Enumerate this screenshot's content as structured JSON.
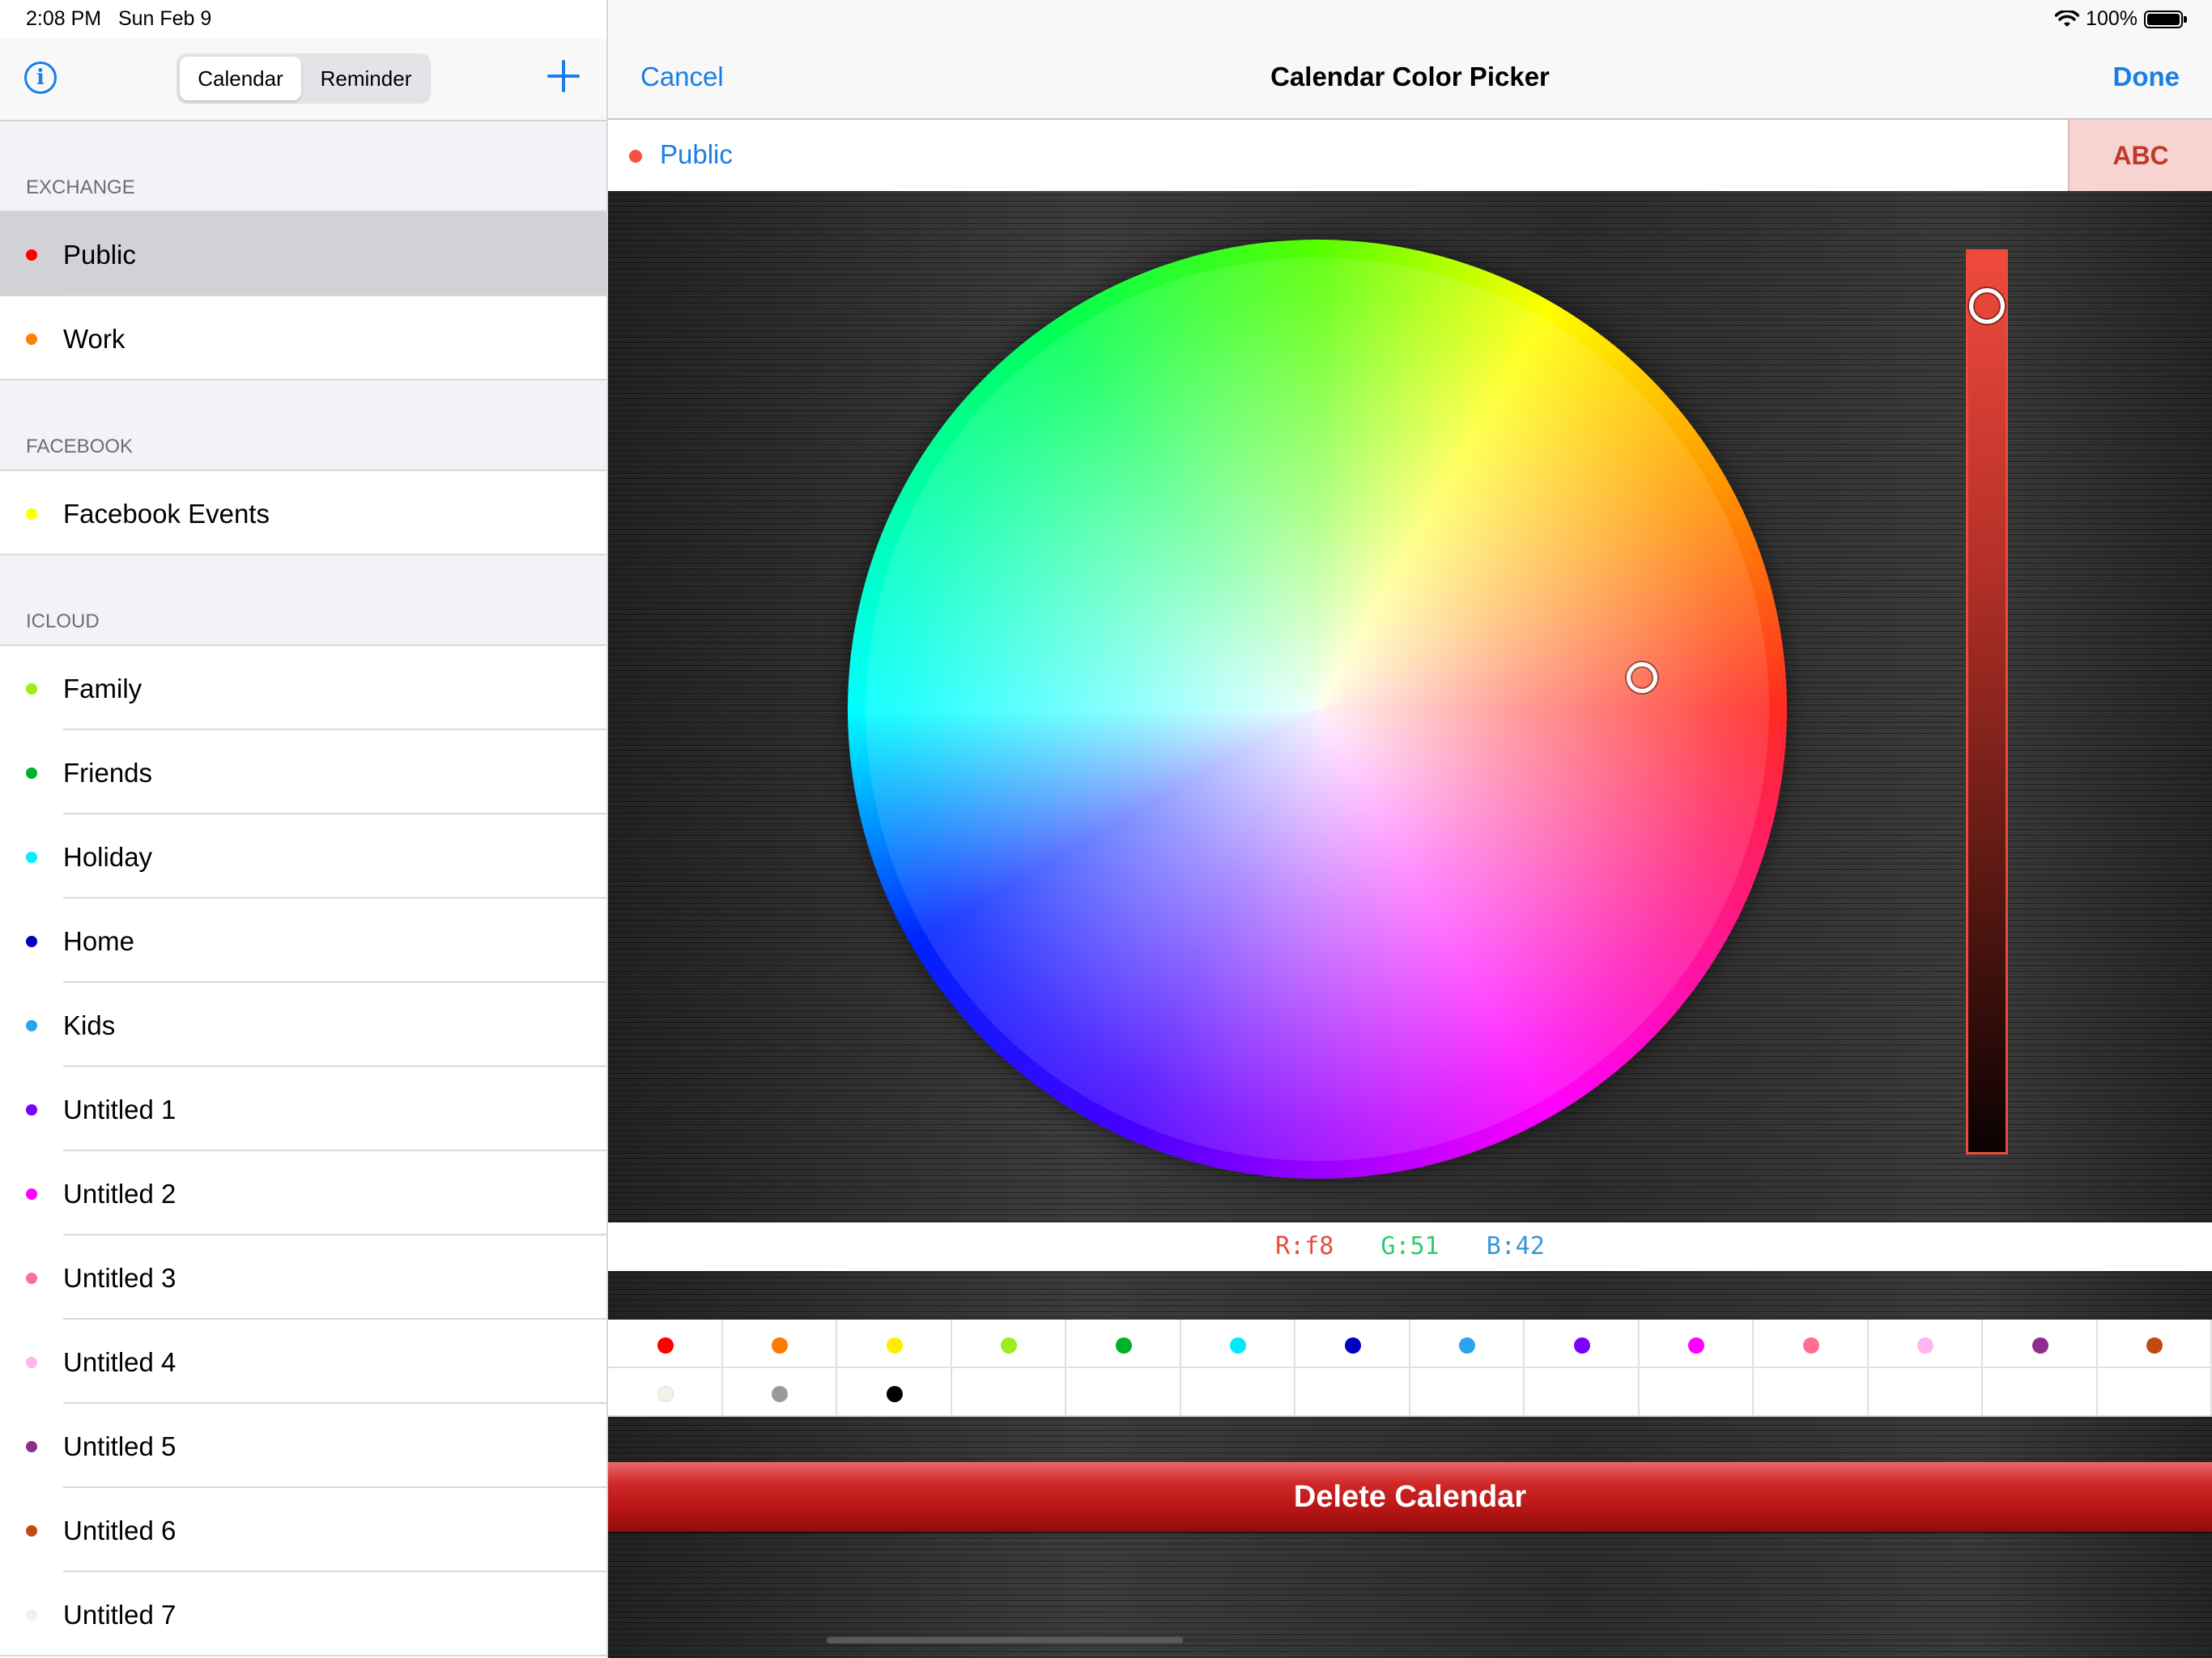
{
  "status_bar": {
    "time": "2:08 PM",
    "date": "Sun Feb 9",
    "battery": "100%"
  },
  "sidebar": {
    "segments": [
      "Calendar",
      "Reminder"
    ],
    "sections": [
      {
        "title": "EXCHANGE",
        "items": [
          {
            "label": "Public",
            "color": "#ff0000",
            "selected": true
          },
          {
            "label": "Work",
            "color": "#ff8000"
          }
        ]
      },
      {
        "title": "FACEBOOK",
        "items": [
          {
            "label": "Facebook Events",
            "color": "#ffff00"
          }
        ]
      },
      {
        "title": "ICLOUD",
        "items": [
          {
            "label": "Family",
            "color": "#9aee1c"
          },
          {
            "label": "Friends",
            "color": "#00b22a"
          },
          {
            "label": "Holiday",
            "color": "#00f0ff"
          },
          {
            "label": "Home",
            "color": "#0000c0"
          },
          {
            "label": "Kids",
            "color": "#2ca3ef"
          },
          {
            "label": "Untitled 1",
            "color": "#7d00ff"
          },
          {
            "label": "Untitled 2",
            "color": "#ff00ff"
          },
          {
            "label": "Untitled 3",
            "color": "#ff6f8e"
          },
          {
            "label": "Untitled 4",
            "color": "#ffb6ee"
          },
          {
            "label": "Untitled 5",
            "color": "#8e2d8e"
          },
          {
            "label": "Untitled 6",
            "color": "#c24a12"
          },
          {
            "label": "Untitled 7",
            "color": "#f4f1e6"
          }
        ]
      }
    ]
  },
  "detail": {
    "cancel": "Cancel",
    "title": "Calendar Color Picker",
    "done": "Done",
    "calendar_name": "Public",
    "calendar_color": "#f85142",
    "preview_text": "ABC",
    "rgb": {
      "r": "R:f8",
      "g": "G:51",
      "b": "B:42"
    },
    "brightness": 0.96,
    "swatches": [
      "#ff0000",
      "#ff7a00",
      "#ffee00",
      "#9aee1c",
      "#00b22a",
      "#00eaff",
      "#0000c0",
      "#2ca3ef",
      "#7d00ff",
      "#ff00ff",
      "#ff6f8e",
      "#ffb6ee",
      "#8e2d8e",
      "#c24a12",
      "#f4f1e6",
      "#9a9a9a",
      "#000000"
    ],
    "delete": "Delete Calendar"
  }
}
